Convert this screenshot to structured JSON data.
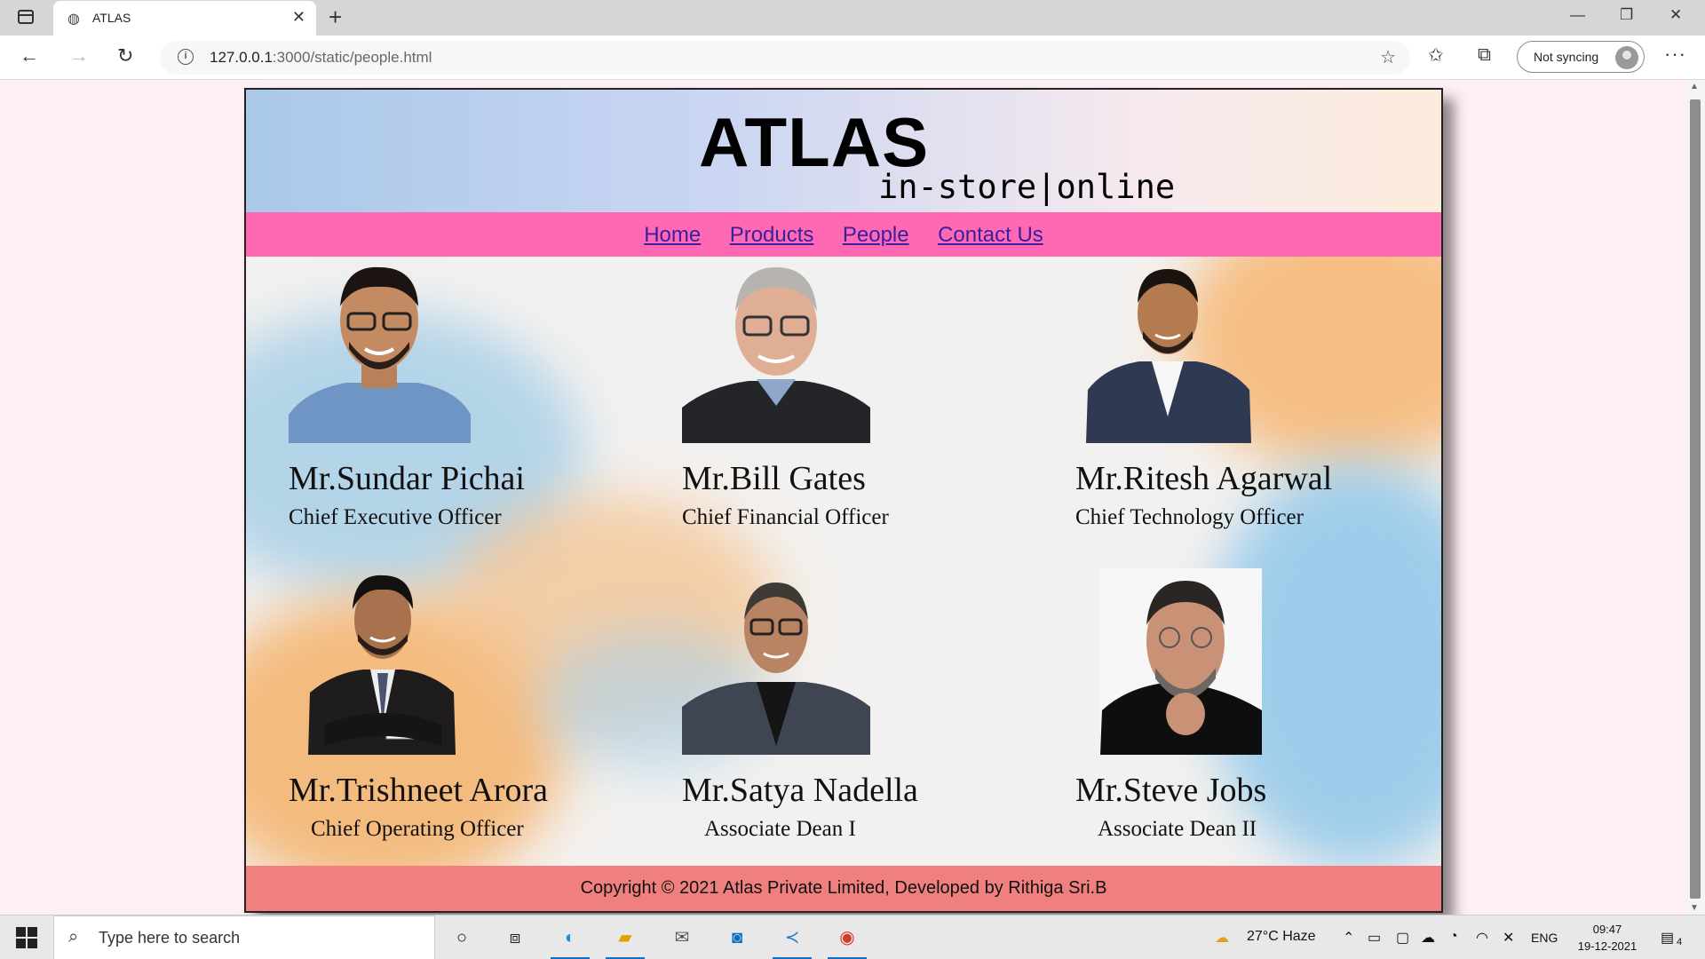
{
  "browser": {
    "tab_title": "ATLAS",
    "url_host": "127.0.0.1",
    "url_rest": ":3000/static/people.html",
    "sync_label": "Not syncing"
  },
  "site": {
    "logo": "ATLAS",
    "tagline": "in-store|online",
    "nav": [
      "Home",
      "Products",
      "People",
      "Contact Us"
    ],
    "people": [
      {
        "name": "Mr.Sundar Pichai",
        "role": "Chief Executive Officer"
      },
      {
        "name": "Mr.Bill Gates",
        "role": "Chief Financial Officer"
      },
      {
        "name": "Mr.Ritesh Agarwal",
        "role": "Chief Technology Officer"
      },
      {
        "name": "Mr.Trishneet Arora",
        "role": "Chief Operating Officer"
      },
      {
        "name": "Mr.Satya Nadella",
        "role": "Associate Dean I"
      },
      {
        "name": "Mr.Steve Jobs",
        "role": "Associate Dean II"
      }
    ],
    "footer": "Copyright © 2021 Atlas Private Limited, Developed by Rithiga Sri.B"
  },
  "taskbar": {
    "search_placeholder": "Type here to search",
    "weather": "27°C  Haze",
    "language": "ENG",
    "time": "09:47",
    "date": "19-12-2021",
    "notification_count": "4"
  },
  "colors": {
    "nav_bg": "#ff69b4",
    "nav_link": "#3a1f9e",
    "footer_bg": "#f08080",
    "page_bg": "#ffeef3"
  }
}
